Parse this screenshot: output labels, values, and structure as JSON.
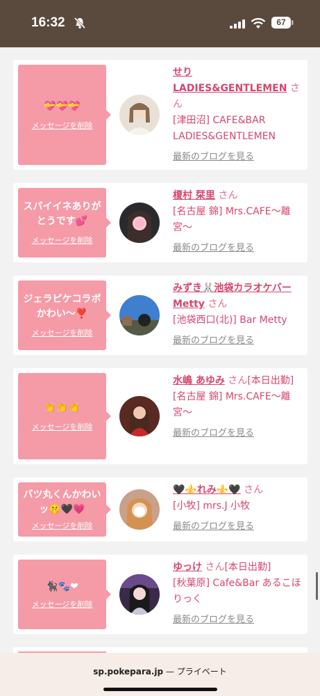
{
  "status_bar": {
    "time": "16:32",
    "battery": "67"
  },
  "common": {
    "delete_label": "メッセージを削除",
    "blog_label": "最新のブログを見る",
    "san": "さん"
  },
  "cards": [
    {
      "message": "💝💝💝",
      "name": "せり LADIES&GENTLEMEN",
      "shop": "[津田沼] CAFE&BAR LADIES&GENTLEMEN"
    },
    {
      "message": "スパイイネありがとうです💕",
      "name": "榎村 栞里",
      "shop": "[名古屋 錦] Mrs.CAFE〜離宮〜"
    },
    {
      "message": "ジェラピケコラボかわい〜❣️",
      "name": "みずき🐰池袋カラオケバーMetty",
      "shop": "[池袋西口(北)] Bar Metty"
    },
    {
      "message": "👏👏👏",
      "name": "水嶋 あゆみ",
      "extra": "[本日出勤]",
      "shop": "[名古屋 錦] Mrs.CAFE〜離宮〜"
    },
    {
      "message": "バツ丸くんかわいッ🤫🖤💗",
      "name": "🖤⚜️れみ⚜️🖤",
      "shop": "[小牧] mrs.J 小牧"
    },
    {
      "message": "🐈‍⬛🐾❤",
      "name": "ゆっけ",
      "extra": "[本日出勤]",
      "shop": "[秋葉原] Cafe&Bar あるこほりっく"
    }
  ],
  "browser": {
    "domain": "sp.pokepara.jp",
    "separator": " — ",
    "mode": "プライベート"
  },
  "colors": {
    "accent": "#d8456c",
    "bubble": "#f59aa7",
    "status_bar": "#5a4a3d"
  }
}
